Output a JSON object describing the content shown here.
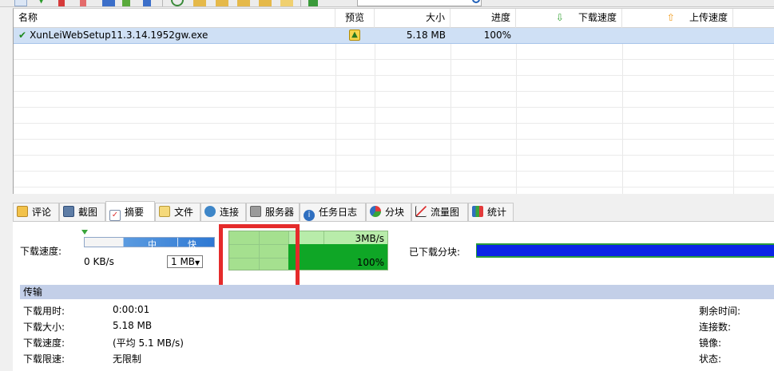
{
  "list": {
    "headers": {
      "name": "名称",
      "preview": "预览",
      "size": "大小",
      "progress": "进度",
      "download_speed": "下载速度",
      "upload_speed": "上传速度"
    },
    "rows": [
      {
        "name": "XunLeiWebSetup11.3.14.1952gw.exe",
        "size": "5.18 MB",
        "progress": "100%",
        "status": "completed"
      }
    ]
  },
  "tabs": [
    {
      "label": "评论",
      "icon": "comment-icon"
    },
    {
      "label": "截图",
      "icon": "screenshot-icon"
    },
    {
      "label": "摘要",
      "icon": "summary-icon",
      "active": true
    },
    {
      "label": "文件",
      "icon": "file-icon"
    },
    {
      "label": "连接",
      "icon": "connection-icon"
    },
    {
      "label": "服务器",
      "icon": "server-icon"
    },
    {
      "label": "任务日志",
      "icon": "info-icon"
    },
    {
      "label": "分块",
      "icon": "pie-icon"
    },
    {
      "label": "流量图",
      "icon": "traffic-chart-icon"
    },
    {
      "label": "统计",
      "icon": "stats-icon"
    }
  ],
  "summary": {
    "speed_label": "下载速度:",
    "slider": {
      "mid": "中",
      "fast": "快",
      "level": 0.3
    },
    "current_speed": "0 KB/s",
    "limit_value": "1 MB",
    "graph": {
      "max_label": "3MB/s",
      "progress_label": "100%",
      "progress": 1.0
    },
    "chunks_label": "已下载分块:",
    "chunks_progress": 1.0
  },
  "transfer": {
    "title": "传输",
    "left": [
      {
        "label": "下载用时:",
        "value": "0:00:01"
      },
      {
        "label": "下载大小:",
        "value": "5.18 MB"
      },
      {
        "label": "下载速度:",
        "value": "(平均 5.1 MB/s)"
      },
      {
        "label": "下载限速:",
        "value": "无限制"
      }
    ],
    "right": [
      {
        "label": "剩余时间:"
      },
      {
        "label": "连接数:"
      },
      {
        "label": "镜像:"
      },
      {
        "label": "状态:"
      }
    ]
  },
  "colors": {
    "selected_row": "#cfe0f5",
    "graph_fill": "#0fa626",
    "chunks_bar": "#0b25e6",
    "highlight_box": "#e52b2b",
    "section_header": "#c3cfe8"
  }
}
